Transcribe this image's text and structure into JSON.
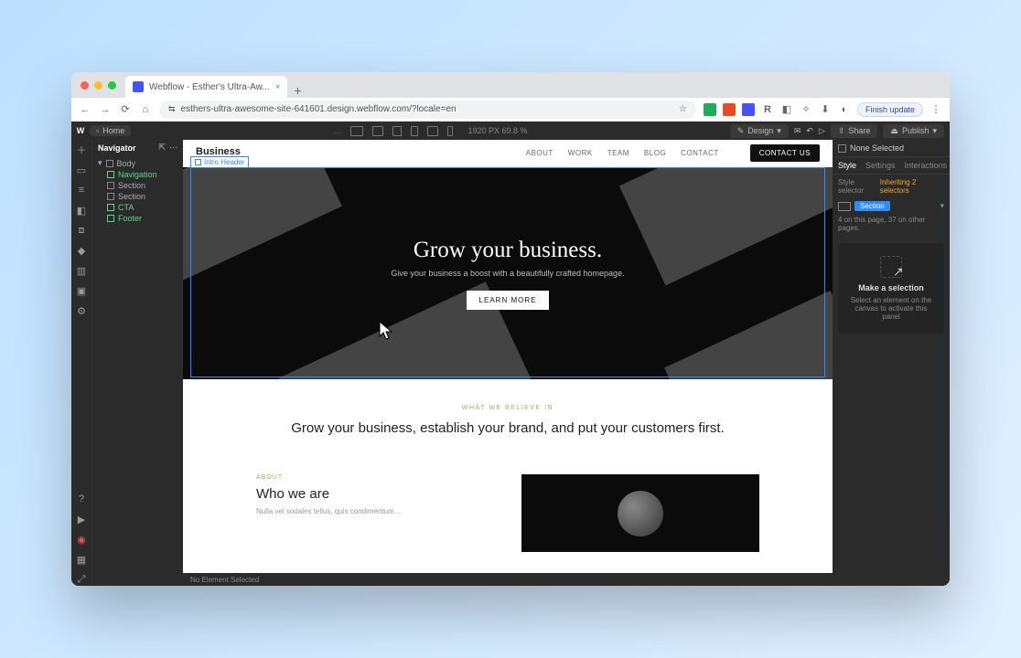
{
  "browser": {
    "tab_title": "Webflow - Esther's Ultra-Aw...",
    "url": "esthers-ultra-awesome-site-641601.design.webflow.com/?locale=en",
    "update_button": "Finish update"
  },
  "topbar": {
    "home": "Home",
    "dims": "1920 PX 69.8 %",
    "design": "Design",
    "share": "Share",
    "publish": "Publish"
  },
  "navigator": {
    "title": "Navigator",
    "items": [
      {
        "label": "Body"
      },
      {
        "label": "Navigation"
      },
      {
        "label": "Section"
      },
      {
        "label": "Section"
      },
      {
        "label": "CTA"
      },
      {
        "label": "Footer"
      }
    ]
  },
  "selection": {
    "element_tag": "Intro Header"
  },
  "page": {
    "brand": "Business",
    "nav": [
      "ABOUT",
      "WORK",
      "TEAM",
      "BLOG",
      "CONTACT"
    ],
    "contact_btn": "CONTACT US",
    "hero_title": "Grow your business.",
    "hero_sub": "Give your business a boost with a beautifully crafted homepage.",
    "hero_cta": "LEARN MORE",
    "eyebrow": "WHAT WE BELIEVE IN",
    "mission": "Grow your business, establish your brand, and put your customers first.",
    "about_label": "ABOUT",
    "about_title": "Who we are",
    "about_body": "Nulla vel sodales tellus, quis condimentum..."
  },
  "statusbar": {
    "text": "No Element Selected"
  },
  "rightpanel": {
    "none_selected": "None Selected",
    "tabs": [
      "Style",
      "Settings",
      "Interactions"
    ],
    "style_selector_label": "Style selector",
    "inheriting": "Inheriting 2 selectors",
    "chip": "Section",
    "count": "4 on this page, 37 on other pages.",
    "empty_title": "Make a selection",
    "empty_body": "Select an element on the canvas to activate this panel"
  }
}
